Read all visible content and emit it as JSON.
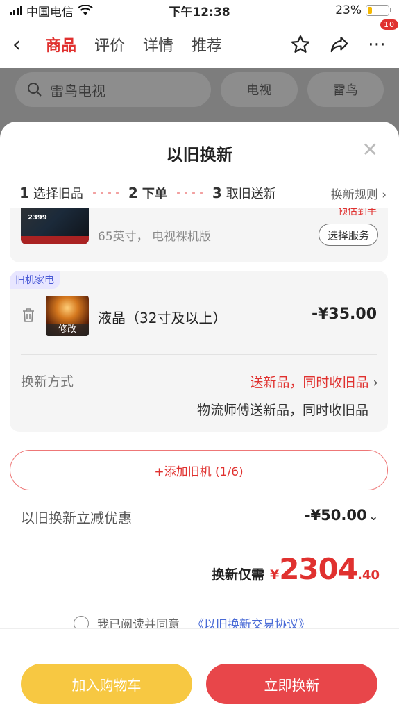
{
  "status_bar": {
    "carrier": "中国电信",
    "time": "下午12:38",
    "battery": "23%",
    "battery_level": 0.23
  },
  "nav": {
    "tabs": [
      {
        "label": "商品",
        "active": true
      },
      {
        "label": "评价"
      },
      {
        "label": "详情"
      },
      {
        "label": "推荐"
      }
    ],
    "badge": "10"
  },
  "underlay": {
    "search_placeholder": "雷鸟电视",
    "chips": [
      "电视",
      "雷鸟"
    ]
  },
  "sheet": {
    "title": "以旧换新",
    "steps": [
      {
        "num": "1",
        "label": "选择旧品"
      },
      {
        "num": "2",
        "label": "下单"
      },
      {
        "num": "3",
        "label": "取旧送新"
      }
    ],
    "rules_link": "换新规则 ›",
    "product": {
      "thumb_price": "2399",
      "spec": "65英寸， 电视裸机版",
      "estimate": "预估到手",
      "service_button": "选择服务"
    },
    "old_item": {
      "tag": "旧机家电",
      "edit_label": "修改",
      "name": "液晶（32寸及以上）",
      "price": "-¥35.00",
      "method_label": "换新方式",
      "method_value": "送新品，同时收旧品",
      "method_sub": "物流师傅送新品，同时收旧品"
    },
    "add_button": "+添加旧机 (1/6)",
    "discount": {
      "label": "以旧换新立减优惠",
      "value": "-¥50.00"
    },
    "total": {
      "label": "换新仅需",
      "currency": "¥",
      "integer": "2304",
      "decimal": ".40"
    },
    "agreement": {
      "text": "我已阅读并同意",
      "link": "《以旧换新交易协议》"
    },
    "buttons": {
      "cart": "加入购物车",
      "buy": "立即换新"
    }
  },
  "colors": {
    "accent": "#e0312f",
    "cart": "#f7c842",
    "buy": "#e8464a"
  }
}
